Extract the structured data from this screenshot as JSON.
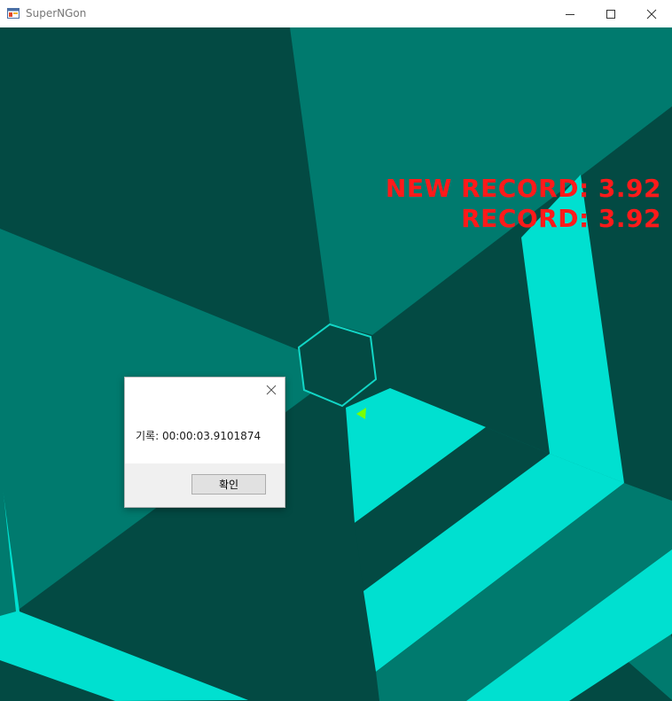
{
  "window": {
    "title": "SuperNGon",
    "icon": "app-window-icon",
    "controls": [
      "minimize-icon",
      "maximize-icon",
      "close-icon"
    ]
  },
  "hud": {
    "new_record": "NEW RECORD: 3.92",
    "record": "RECORD: 3.92",
    "color": "#ff1a1a"
  },
  "dialog": {
    "message": "기록: 00:00:03.9101874",
    "ok_label": "확인"
  },
  "colors": {
    "dark_wall": "#034a43",
    "mid_wall": "#007a6e",
    "bright_wall": "#00e0d0",
    "hexagon_outline": "#12d6c6",
    "player": "#7aff00"
  }
}
